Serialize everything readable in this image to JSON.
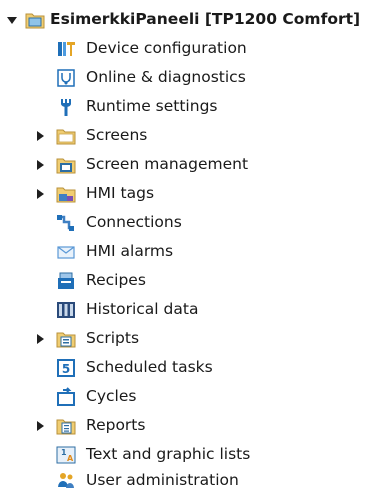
{
  "tree": {
    "root": {
      "label": "EsimerkkiPaneeli [TP1200 Comfort]",
      "icon": "hmi-panel-icon",
      "expanded": true
    },
    "items": [
      {
        "label": "Device configuration",
        "icon": "device-configuration-icon",
        "expandable": false
      },
      {
        "label": "Online & diagnostics",
        "icon": "online-diagnostics-icon",
        "expandable": false
      },
      {
        "label": "Runtime settings",
        "icon": "runtime-settings-icon",
        "expandable": false
      },
      {
        "label": "Screens",
        "icon": "folder-icon",
        "expandable": true
      },
      {
        "label": "Screen management",
        "icon": "screen-management-icon",
        "expandable": true
      },
      {
        "label": "HMI tags",
        "icon": "hmi-tags-icon",
        "expandable": true
      },
      {
        "label": "Connections",
        "icon": "connections-icon",
        "expandable": false
      },
      {
        "label": "HMI alarms",
        "icon": "hmi-alarms-icon",
        "expandable": false
      },
      {
        "label": "Recipes",
        "icon": "recipes-icon",
        "expandable": false
      },
      {
        "label": "Historical data",
        "icon": "historical-data-icon",
        "expandable": false
      },
      {
        "label": "Scripts",
        "icon": "scripts-icon",
        "expandable": true
      },
      {
        "label": "Scheduled tasks",
        "icon": "scheduled-tasks-icon",
        "expandable": false
      },
      {
        "label": "Cycles",
        "icon": "cycles-icon",
        "expandable": false
      },
      {
        "label": "Reports",
        "icon": "reports-icon",
        "expandable": true
      },
      {
        "label": "Text and graphic lists",
        "icon": "text-graphic-lists-icon",
        "expandable": false
      },
      {
        "label": "User administration",
        "icon": "user-administration-icon",
        "expandable": false
      }
    ]
  },
  "colors": {
    "folder": "#e8c36a",
    "blue": "#1f6fb8",
    "text": "#1a1a1a"
  }
}
